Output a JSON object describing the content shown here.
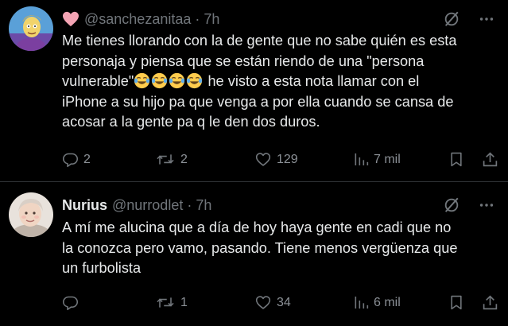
{
  "tweets": [
    {
      "display_name": "",
      "handle": "@sanchezanitaa",
      "separator": "·",
      "time": "7h",
      "lines": [
        "Me tienes llorando con la de gente que no sabe quién es esta",
        "personaja y piensa que se están riendo de una \"persona",
        "vulnerable\"",
        " he visto a esta nota llamar con el",
        "iPhone a su hijo pa que venga a por ella cuando se cansa de",
        "acosar a la gente pa q le den dos duros."
      ],
      "actions": {
        "replies": "2",
        "reposts": "2",
        "likes": "129",
        "views": "7 mil"
      }
    },
    {
      "display_name": "Nurius",
      "handle": "@nurrodlet",
      "separator": "·",
      "time": "7h",
      "lines": [
        "A mí me alucina que a día de hoy haya gente en cadi que no",
        "la conozca pero vamo, pasando. Tiene menos vergüenza que",
        "un furbolista"
      ],
      "actions": {
        "replies": "",
        "reposts": "1",
        "likes": "34",
        "views": "6 mil"
      }
    }
  ],
  "icons": {
    "heart_emoji": "heart-emoji-icon",
    "laugh_emoji": "tears-of-joy-emoji-icon",
    "grok": "grok-icon",
    "more": "more-icon",
    "reply": "reply-icon",
    "repost": "repost-icon",
    "like": "like-icon",
    "views": "views-icon",
    "bookmark": "bookmark-icon",
    "share": "share-icon"
  },
  "colors": {
    "background": "#000000",
    "text": "#e7e9ea",
    "secondary": "#71767b",
    "divider": "#2f3336",
    "heart_emoji": "#f4a4b4"
  }
}
